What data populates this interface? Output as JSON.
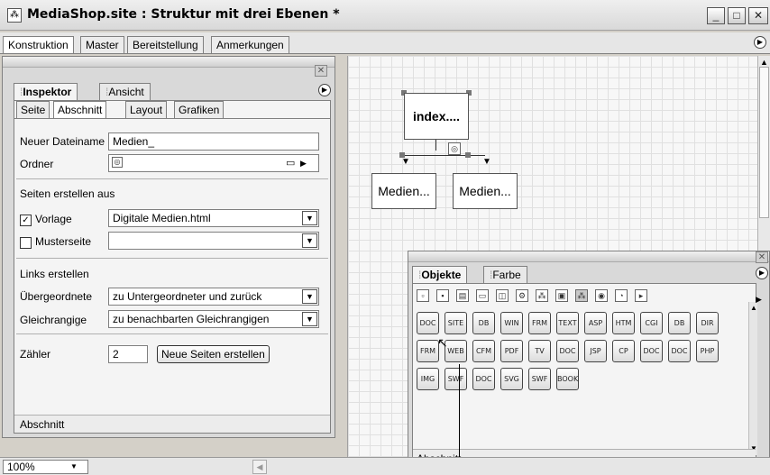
{
  "window": {
    "title": "MediaShop.site : Struktur mit drei Ebenen *",
    "icon": "site-icon",
    "controls": {
      "minimize": "_",
      "maximize": "□",
      "close": "✕"
    }
  },
  "main_tabs": [
    "Konstruktion",
    "Master",
    "Bereitstellung",
    "Anmerkungen"
  ],
  "canvas": {
    "root_page": "index....",
    "child_pages": [
      "Medien...",
      "Medien..."
    ]
  },
  "inspector": {
    "tabs": [
      "Inspektor",
      "Ansicht"
    ],
    "sub_tabs": [
      "Seite",
      "Abschnitt",
      "Layout",
      "Grafiken"
    ],
    "new_filename_label": "Neuer Dateiname",
    "new_filename_value": "Medien_",
    "folder_label": "Ordner",
    "create_pages_heading": "Seiten erstellen aus",
    "template_label": "Vorlage",
    "template_checked": true,
    "template_value": "Digitale Medien.html",
    "master_label": "Musterseite",
    "master_checked": false,
    "master_value": "",
    "links_heading": "Links erstellen",
    "parent_label": "Übergeordnete",
    "parent_value": "zu Untergeordneter und zurück",
    "sibling_label": "Gleichrangige",
    "sibling_value": "zu benachbarten Gleichrangigen",
    "counter_label": "Zähler",
    "counter_value": "2",
    "create_button": "Neue Seiten erstellen",
    "status": "Abschnitt"
  },
  "objects_panel": {
    "tabs": [
      "Objekte",
      "Farbe"
    ],
    "toolbar_count": 12,
    "selected_tool_index": 8,
    "object_rows": [
      [
        "DOC",
        "SITE",
        "DB",
        "WIN",
        "FRM",
        "TEXT",
        "ASP",
        "HTM",
        "CGI",
        "DB",
        "DIR"
      ],
      [
        "FRM",
        "WEB",
        "CFM",
        "PDF",
        "TV",
        "DOC",
        "JSP",
        "CP",
        "DOC",
        "DOC",
        "PHP"
      ],
      [
        "IMG",
        "SWF",
        "DOC",
        "SVG",
        "SWF",
        "BOOK"
      ]
    ],
    "status": "Abschnitt"
  },
  "bottom_bar": {
    "zoom": "100%"
  }
}
